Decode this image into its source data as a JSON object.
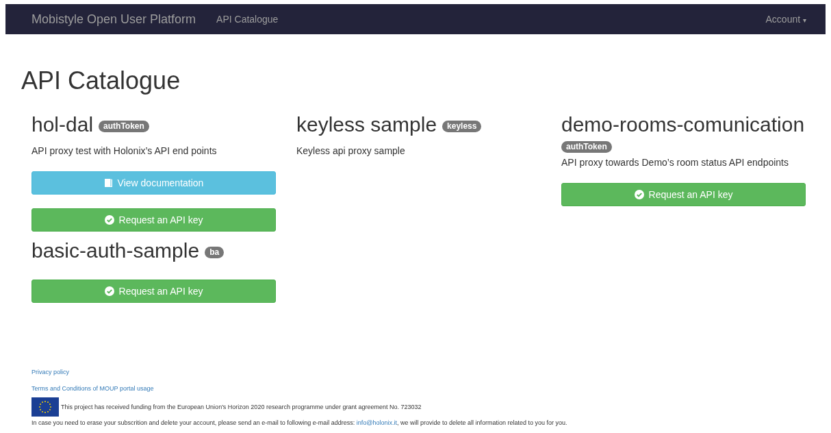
{
  "navbar": {
    "brand": "Mobistyle Open User Platform",
    "links": [
      {
        "label": "API Catalogue"
      }
    ],
    "account": {
      "label": "Account",
      "caret": "▾"
    }
  },
  "page_title": "API Catalogue",
  "api_columns": [
    {
      "apis": [
        {
          "name": "hol-dal",
          "badge": "authToken",
          "description": "API proxy test with Holonix’s API end points",
          "buttons": [
            {
              "kind": "docs",
              "label": "View documentation"
            },
            {
              "kind": "request",
              "label": "Request an API key"
            }
          ]
        },
        {
          "name": "basic-auth-sample",
          "badge": "ba",
          "buttons": [
            {
              "kind": "request",
              "label": "Request an API key"
            }
          ]
        }
      ]
    },
    {
      "apis": [
        {
          "name": "keyless sample",
          "badge": "keyless",
          "description": "Keyless api proxy sample"
        }
      ]
    },
    {
      "apis": [
        {
          "name": "demo-rooms-comunication",
          "badge": "authToken",
          "description": "API proxy towards Demo’s room status API endpoints",
          "buttons": [
            {
              "kind": "request",
              "label": "Request an API key"
            }
          ]
        }
      ]
    }
  ],
  "footer": {
    "links": [
      "Privacy policy",
      "Terms and Conditions of MOUP portal usage"
    ],
    "funding": "This project has received funding from the European Union's Horizon 2020 research programme under grant agreement No. 723032",
    "erase_before": "In case you need to erase your subscrition and delete your account, please send an e-mail to following e-mail address:",
    "erase_link": "info@holonix.it",
    "erase_after": ", we will provide to delete all information related to you for you."
  }
}
